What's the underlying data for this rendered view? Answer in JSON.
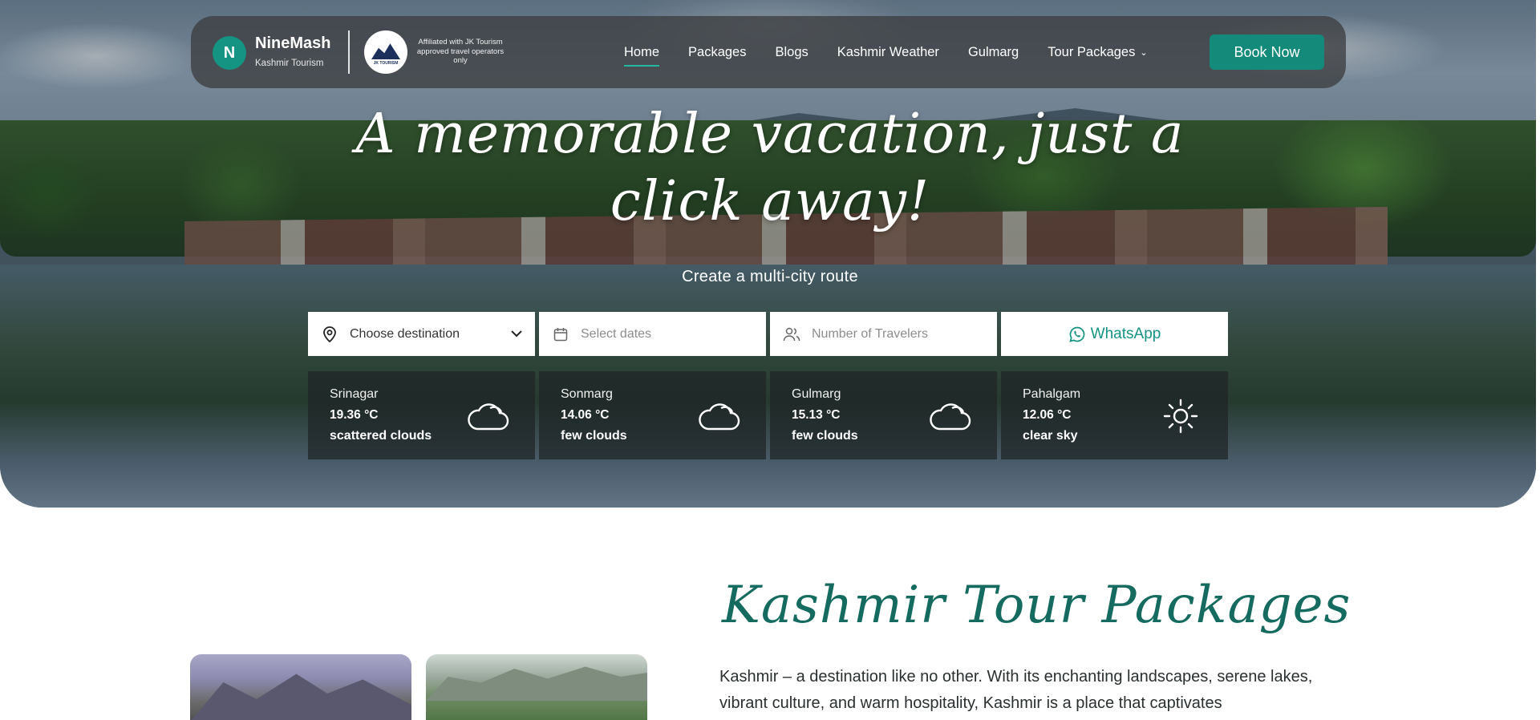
{
  "brand": {
    "initial": "N",
    "name": "NineMash",
    "subtitle": "Kashmir Tourism",
    "badge_text": "JK TOURISM",
    "affiliation": "Affiliated with JK Tourism approved travel operators only"
  },
  "nav": {
    "items": [
      {
        "label": "Home",
        "active": true
      },
      {
        "label": "Packages"
      },
      {
        "label": "Blogs"
      },
      {
        "label": "Kashmir Weather"
      },
      {
        "label": "Gulmarg"
      },
      {
        "label": "Tour Packages",
        "has_dropdown": true
      }
    ],
    "cta": "Book Now"
  },
  "hero": {
    "headline": "A memorable vacation, just a click away!",
    "subhead": "Create a multi-city route"
  },
  "search": {
    "destination": {
      "value": "Choose destination",
      "icon": "map-pin-icon"
    },
    "dates": {
      "placeholder": "Select dates",
      "icon": "calendar-icon"
    },
    "travelers": {
      "placeholder": "Number of Travelers",
      "icon": "users-icon"
    },
    "whatsapp": {
      "label": "WhatsApp",
      "icon": "whatsapp-icon"
    }
  },
  "weather": [
    {
      "city": "Srinagar",
      "temp": "19.36 °C",
      "desc": "scattered clouds",
      "icon": "cloud-icon"
    },
    {
      "city": "Sonmarg",
      "temp": "14.06 °C",
      "desc": "few clouds",
      "icon": "cloud-icon"
    },
    {
      "city": "Gulmarg",
      "temp": "15.13 °C",
      "desc": "few clouds",
      "icon": "cloud-icon"
    },
    {
      "city": "Pahalgam",
      "temp": "12.06 °C",
      "desc": "clear sky",
      "icon": "sun-icon"
    }
  ],
  "section": {
    "title": "Kashmir Tour Packages",
    "body": "Kashmir – a destination like no other. With its enchanting landscapes, serene lakes, vibrant culture, and warm hospitality, Kashmir is a place that captivates"
  },
  "colors": {
    "accent": "#148a7a",
    "title": "#156b5f",
    "nav_bg": "#3c3e40"
  }
}
